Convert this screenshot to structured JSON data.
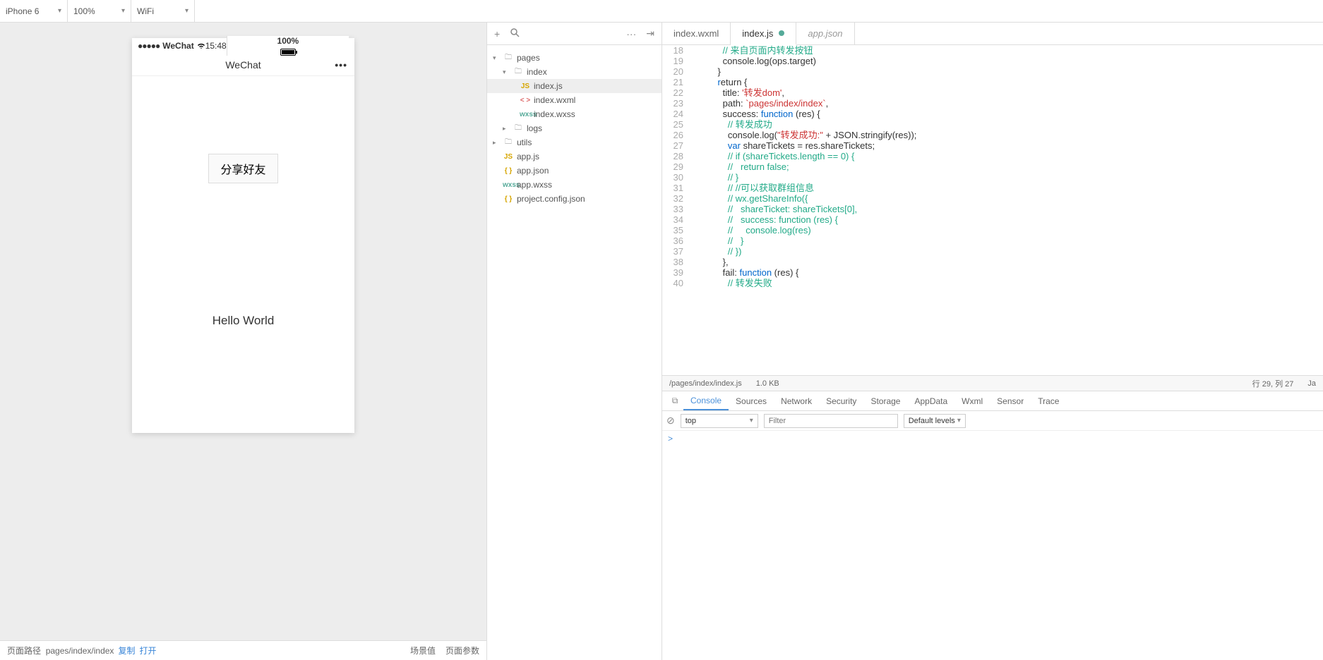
{
  "topbar": {
    "device": "iPhone 6",
    "zoom": "100%",
    "network": "WiFi"
  },
  "simulator": {
    "status": {
      "carrier": "WeChat",
      "time": "15:48",
      "battery": "100%"
    },
    "nav": {
      "title": "WeChat"
    },
    "share_btn": "分享好友",
    "hello": "Hello World"
  },
  "simfooter": {
    "path_label": "页面路径",
    "path": "pages/index/index",
    "copy": "复制",
    "open": "打开",
    "scene": "场景值",
    "params": "页面参数"
  },
  "filetree": {
    "root": "pages",
    "index_folder": "index",
    "index_js": "index.js",
    "index_wxml": "index.wxml",
    "index_wxss": "index.wxss",
    "logs": "logs",
    "utils": "utils",
    "app_js": "app.js",
    "app_json": "app.json",
    "app_wxss": "app.wxss",
    "project_config": "project.config.json"
  },
  "tabs": {
    "t1": "index.wxml",
    "t2": "index.js",
    "t3": "app.json"
  },
  "status": {
    "path": "/pages/index/index.js",
    "size": "1.0 KB",
    "cursor": "行 29, 列 27",
    "lang": "Ja"
  },
  "code": {
    "lines": [
      18,
      19,
      20,
      21,
      22,
      23,
      24,
      25,
      26,
      27,
      28,
      29,
      30,
      31,
      32,
      33,
      34,
      35,
      36,
      37,
      38,
      39,
      40
    ]
  },
  "devtools": {
    "tabs": {
      "console": "Console",
      "sources": "Sources",
      "network": "Network",
      "security": "Security",
      "storage": "Storage",
      "appdata": "AppData",
      "wxml": "Wxml",
      "sensor": "Sensor",
      "trace": "Trace"
    },
    "context": "top",
    "filter_placeholder": "Filter",
    "levels": "Default levels",
    "prompt": ">"
  }
}
